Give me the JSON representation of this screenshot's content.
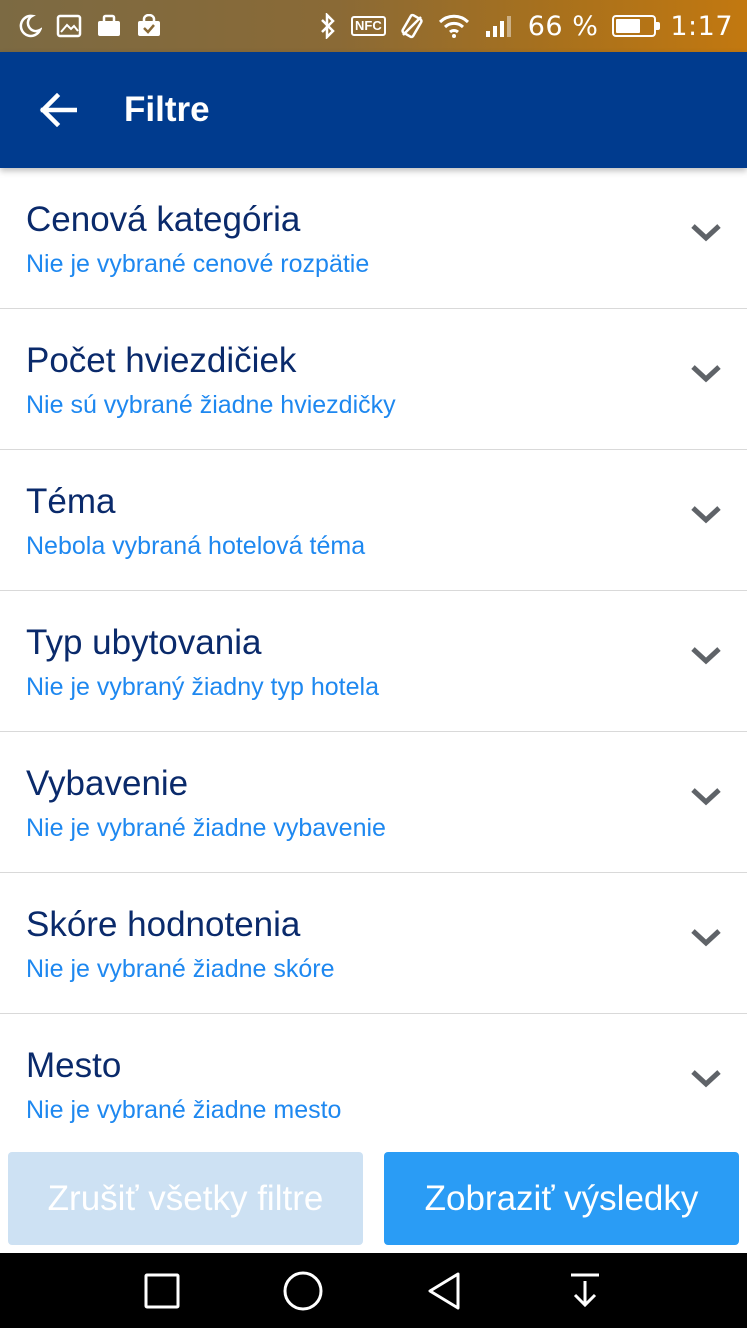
{
  "status_bar": {
    "battery_percent": "66 %",
    "battery_level": 0.66,
    "time": "1:17",
    "nfc_label": "NFC",
    "icons": [
      "moon-icon",
      "image-icon",
      "briefcase-icon",
      "shopping-bag-icon",
      "bluetooth-icon",
      "nfc-icon",
      "vibrate-icon",
      "wifi-icon",
      "signal-icon",
      "battery-icon"
    ]
  },
  "app_bar": {
    "back_icon": "arrow-left-icon",
    "title": "Filtre"
  },
  "filters": [
    {
      "title": "Cenová kategória",
      "subtitle": "Nie je vybrané cenové rozpätie"
    },
    {
      "title": "Počet hviezdičiek",
      "subtitle": "Nie sú vybrané žiadne hviezdičky"
    },
    {
      "title": "Téma",
      "subtitle": "Nebola vybraná hotelová téma"
    },
    {
      "title": "Typ ubytovania",
      "subtitle": "Nie je vybraný žiadny typ hotela"
    },
    {
      "title": "Vybavenie",
      "subtitle": "Nie je vybrané žiadne vybavenie"
    },
    {
      "title": "Skóre hodnotenia",
      "subtitle": "Nie je vybrané žiadne skóre"
    },
    {
      "title": "Mesto",
      "subtitle": "Nie je vybrané žiadne mesto"
    }
  ],
  "buttons": {
    "clear_all": "Zrušiť všetky filtre",
    "show_results": "Zobraziť výsledky"
  },
  "colors": {
    "app_bar": "#003b8e",
    "title_text": "#0a2a6b",
    "subtitle_text": "#1e88f0",
    "primary_button": "#2a9cf5",
    "disabled_button": "#cde1f3"
  },
  "nav_bar": {
    "icons": [
      "recents-square-icon",
      "home-circle-icon",
      "back-triangle-icon",
      "notification-pull-icon"
    ]
  }
}
